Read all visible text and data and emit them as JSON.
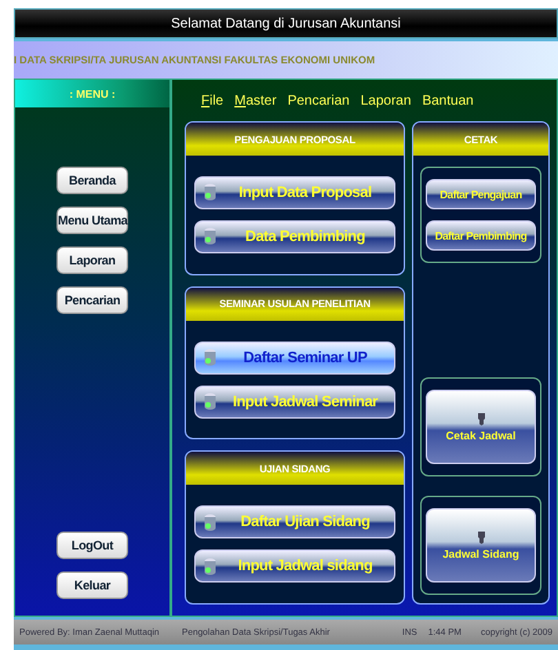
{
  "window": {
    "title": "Selamat Datang di Jurusan Akuntansi"
  },
  "header": {
    "text": "I DATA SKRIPSI/TA JURUSAN AKUNTANSI FAKULTAS EKONOMI UNIKOM"
  },
  "sidebar": {
    "title": ": MENU :",
    "top_buttons": [
      "Beranda",
      "Menu Utama",
      "Laporan",
      "Pencarian"
    ],
    "bottom_buttons": [
      "LogOut",
      "Keluar"
    ]
  },
  "menubar": [
    {
      "label": "File",
      "mnemonic": true
    },
    {
      "label": "Master",
      "mnemonic": true
    },
    {
      "label": "Pencarian",
      "mnemonic": false
    },
    {
      "label": "Laporan",
      "mnemonic": false
    },
    {
      "label": "Bantuan",
      "mnemonic": false
    }
  ],
  "groups": [
    {
      "title": "PENGAJUAN PROPOSAL",
      "buttons": [
        {
          "label": "Input Data Proposal",
          "selected": false
        },
        {
          "label": "Data Pembimbing",
          "selected": false
        }
      ]
    },
    {
      "title": "SEMINAR USULAN PENELITIAN",
      "buttons": [
        {
          "label": "Daftar Seminar UP",
          "selected": true
        },
        {
          "label": "Input Jadwal Seminar",
          "selected": false
        }
      ]
    },
    {
      "title": "UJIAN SIDANG",
      "buttons": [
        {
          "label": "Daftar Ujian Sidang",
          "selected": false
        },
        {
          "label": "Input Jadwal sidang",
          "selected": false
        }
      ]
    }
  ],
  "print_panel": {
    "title": "CETAK",
    "sections": [
      {
        "kind": "small",
        "buttons": [
          "Daftar Pengajuan",
          "Daftar Pembimbing"
        ]
      },
      {
        "kind": "large",
        "buttons": [
          "Cetak Jadwal"
        ]
      },
      {
        "kind": "large",
        "buttons": [
          "Jadwal Sidang"
        ]
      }
    ]
  },
  "status_bar": [
    "Powered By: Iman Zaenal Muttaqin",
    "Pengolahan Data Skripsi/Tugas Akhir",
    "INS",
    "1:44 PM",
    "copyright (c) 2009"
  ]
}
